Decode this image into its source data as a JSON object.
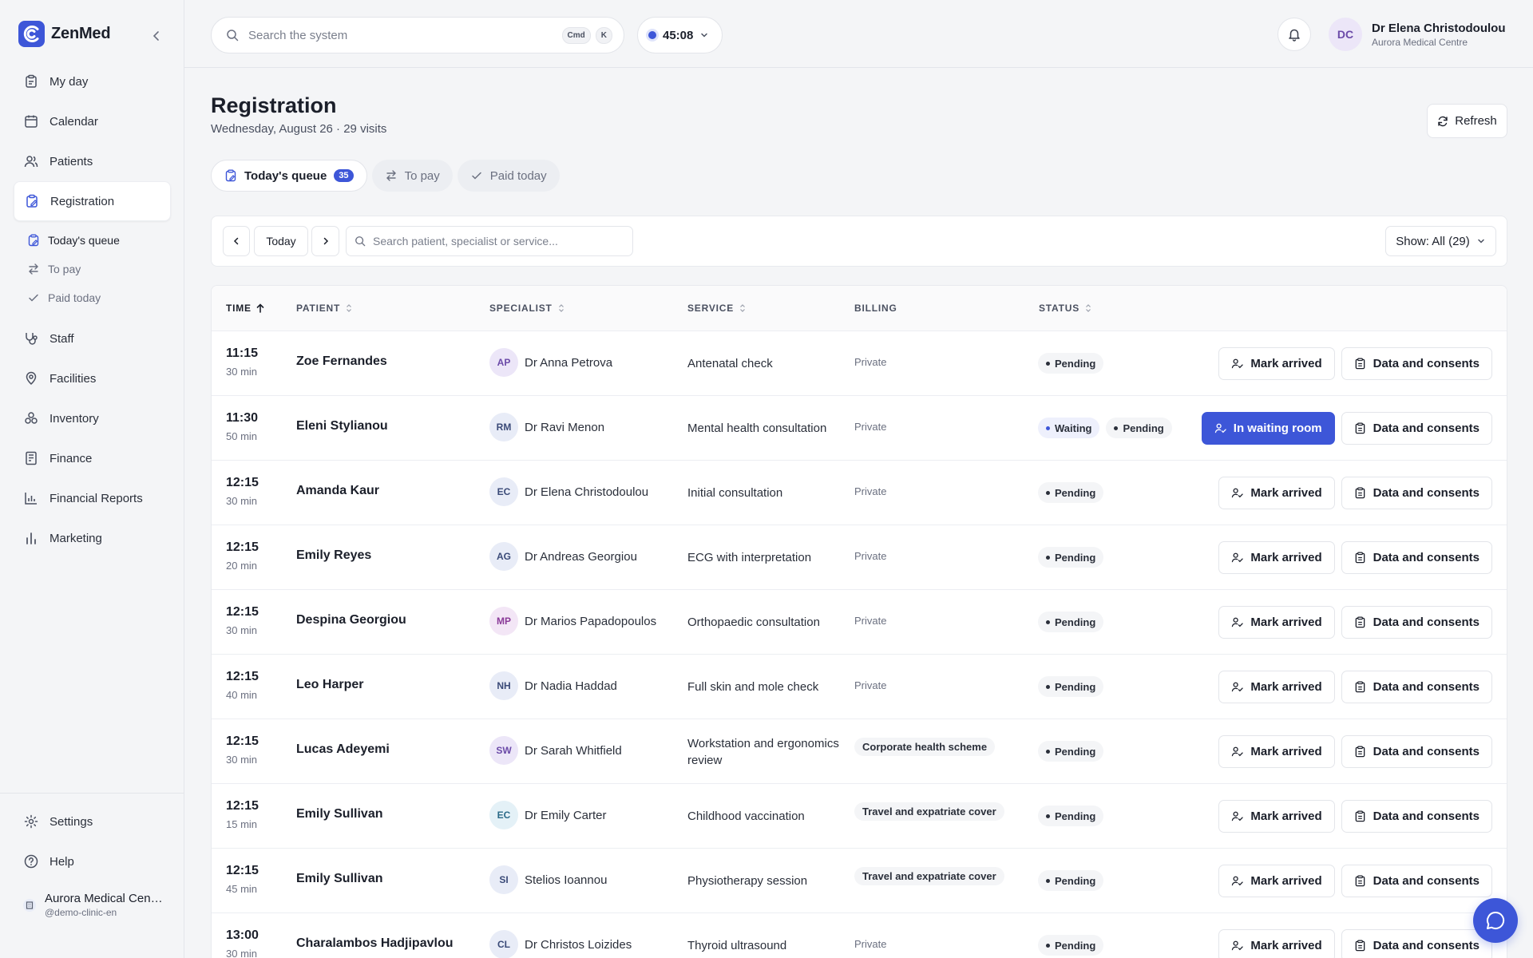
{
  "app": {
    "name": "ZenMed"
  },
  "sidebar": {
    "items": [
      {
        "label": "My day",
        "icon": "clipboard-icon"
      },
      {
        "label": "Calendar",
        "icon": "calendar-icon"
      },
      {
        "label": "Patients",
        "icon": "users-icon"
      },
      {
        "label": "Registration",
        "icon": "clipboard-edit-icon",
        "active": true
      },
      {
        "label": "Staff",
        "icon": "stethoscope-icon"
      },
      {
        "label": "Facilities",
        "icon": "map-pin-icon"
      },
      {
        "label": "Inventory",
        "icon": "boxes-icon"
      },
      {
        "label": "Finance",
        "icon": "receipt-icon"
      },
      {
        "label": "Financial Reports",
        "icon": "bar-chart-icon"
      },
      {
        "label": "Marketing",
        "icon": "chart-bars-icon"
      }
    ],
    "subitems": [
      {
        "label": "Today's queue",
        "icon": "clipboard-edit-icon",
        "active": true
      },
      {
        "label": "To pay",
        "icon": "swap-icon"
      },
      {
        "label": "Paid today",
        "icon": "check-icon"
      }
    ],
    "bottom": [
      {
        "label": "Settings",
        "icon": "gear-icon"
      },
      {
        "label": "Help",
        "icon": "help-circle-icon"
      }
    ],
    "org": {
      "name": "Aurora Medical Centre",
      "handle": "@demo-clinic-en"
    }
  },
  "topbar": {
    "search_placeholder": "Search the system",
    "shortcut": [
      "Cmd",
      "K"
    ],
    "timer": "45:08",
    "user": {
      "initials": "DC",
      "name": "Dr Elena Christodoulou",
      "org": "Aurora Medical Centre"
    }
  },
  "page": {
    "title": "Registration",
    "subtitle": "Wednesday, August 26 · 29 visits",
    "refresh_label": "Refresh",
    "tabs": [
      {
        "label": "Today's queue",
        "count": "35",
        "active": true
      },
      {
        "label": "To pay"
      },
      {
        "label": "Paid today"
      }
    ]
  },
  "toolbar": {
    "today_label": "Today",
    "search_placeholder": "Search patient, specialist or service...",
    "show_label": "Show: All (29)"
  },
  "table": {
    "columns": [
      "TIME",
      "PATIENT",
      "SPECIALIST",
      "SERVICE",
      "BILLING",
      "STATUS"
    ],
    "rows": [
      {
        "time": "11:15",
        "dur": "30 min",
        "patient": "Zoe Fernandes",
        "initials": "AP",
        "spec": "Dr Anna Petrova",
        "av_color": "#ece6f8",
        "av_text": "#6b4aa8",
        "service": "Antenatal check",
        "billing": "Private",
        "billing_pill": false,
        "statuses": [
          "Pending"
        ],
        "primary_action": "Mark arrived",
        "primary": false
      },
      {
        "time": "11:30",
        "dur": "50 min",
        "patient": "Eleni Stylianou",
        "initials": "RM",
        "spec": "Dr Ravi Menon",
        "av_color": "#e8ecf7",
        "av_text": "#3a4a78",
        "service": "Mental health consultation",
        "billing": "Private",
        "billing_pill": false,
        "statuses": [
          "Waiting",
          "Pending"
        ],
        "primary_action": "In waiting room",
        "primary": true
      },
      {
        "time": "12:15",
        "dur": "30 min",
        "patient": "Amanda Kaur",
        "initials": "EC",
        "spec": "Dr Elena Christodoulou",
        "av_color": "#e8ecf7",
        "av_text": "#3a4a78",
        "service": "Initial consultation",
        "billing": "Private",
        "billing_pill": false,
        "statuses": [
          "Pending"
        ],
        "primary_action": "Mark arrived",
        "primary": false
      },
      {
        "time": "12:15",
        "dur": "20 min",
        "patient": "Emily Reyes",
        "initials": "AG",
        "spec": "Dr Andreas Georgiou",
        "av_color": "#e8ecf7",
        "av_text": "#3a4a78",
        "service": "ECG with interpretation",
        "billing": "Private",
        "billing_pill": false,
        "statuses": [
          "Pending"
        ],
        "primary_action": "Mark arrived",
        "primary": false
      },
      {
        "time": "12:15",
        "dur": "30 min",
        "patient": "Despina Georgiou",
        "initials": "MP",
        "spec": "Dr Marios Papadopoulos",
        "av_color": "#f3e6f6",
        "av_text": "#8a3a98",
        "service": "Orthopaedic consultation",
        "billing": "Private",
        "billing_pill": false,
        "statuses": [
          "Pending"
        ],
        "primary_action": "Mark arrived",
        "primary": false
      },
      {
        "time": "12:15",
        "dur": "40 min",
        "patient": "Leo Harper",
        "initials": "NH",
        "spec": "Dr Nadia Haddad",
        "av_color": "#e8ecf7",
        "av_text": "#3a4a78",
        "service": "Full skin and mole check",
        "billing": "Private",
        "billing_pill": false,
        "statuses": [
          "Pending"
        ],
        "primary_action": "Mark arrived",
        "primary": false
      },
      {
        "time": "12:15",
        "dur": "30 min",
        "patient": "Lucas Adeyemi",
        "initials": "SW",
        "spec": "Dr Sarah Whitfield",
        "av_color": "#ece6f8",
        "av_text": "#6b4aa8",
        "service": "Workstation and ergonomics review",
        "billing": "Corporate health scheme",
        "billing_pill": true,
        "statuses": [
          "Pending"
        ],
        "primary_action": "Mark arrived",
        "primary": false
      },
      {
        "time": "12:15",
        "dur": "15 min",
        "patient": "Emily Sullivan",
        "initials": "EC",
        "spec": "Dr Emily Carter",
        "av_color": "#e4f1f7",
        "av_text": "#2a6a88",
        "service": "Childhood vaccination",
        "billing": "Travel and expatriate cover",
        "billing_pill": true,
        "statuses": [
          "Pending"
        ],
        "primary_action": "Mark arrived",
        "primary": false
      },
      {
        "time": "12:15",
        "dur": "45 min",
        "patient": "Emily Sullivan",
        "initials": "SI",
        "spec": "Stelios Ioannou",
        "av_color": "#e8ecf7",
        "av_text": "#3a4a78",
        "service": "Physiotherapy session",
        "billing": "Travel and expatriate cover",
        "billing_pill": true,
        "statuses": [
          "Pending"
        ],
        "primary_action": "Mark arrived",
        "primary": false
      },
      {
        "time": "13:00",
        "dur": "30 min",
        "patient": "Charalambos Hadjipavlou",
        "initials": "CL",
        "spec": "Dr Christos Loizides",
        "av_color": "#e8ecf7",
        "av_text": "#3a4a78",
        "service": "Thyroid ultrasound",
        "billing": "Private",
        "billing_pill": false,
        "statuses": [
          "Pending"
        ],
        "primary_action": "Mark arrived",
        "primary": false
      }
    ],
    "secondary_action": "Data and consents"
  },
  "colors": {
    "accent": "#3d56d8"
  }
}
